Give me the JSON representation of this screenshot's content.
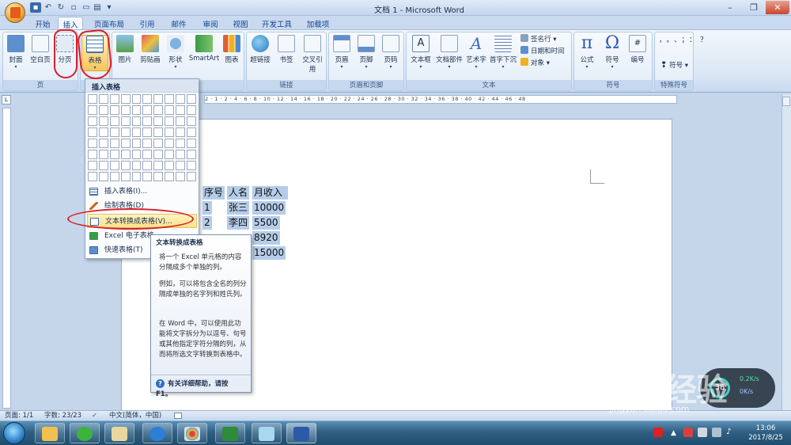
{
  "window": {
    "title": "文档 1 - Microsoft Word"
  },
  "tabs": [
    "开始",
    "插入",
    "页面布局",
    "引用",
    "邮件",
    "审阅",
    "视图",
    "开发工具",
    "加载项"
  ],
  "ribbon": {
    "pages": {
      "label": "页",
      "buttons": [
        "封面",
        "空白页",
        "分页"
      ]
    },
    "tables": {
      "buttons": [
        "表格"
      ]
    },
    "illustrations": {
      "buttons": [
        "图片",
        "剪贴画",
        "形状",
        "SmartArt",
        "图表"
      ]
    },
    "links": {
      "label": "链接",
      "buttons": [
        "超链接",
        "书签",
        "交叉引用"
      ]
    },
    "header_footer": {
      "label": "页眉和页脚",
      "buttons": [
        "页眉",
        "页脚",
        "页码"
      ]
    },
    "text": {
      "label": "文本",
      "buttons": [
        "文本框",
        "文档部件",
        "艺术字",
        "首字下沉"
      ],
      "small": [
        "签名行",
        "日期和时间",
        "对象"
      ]
    },
    "symbols": {
      "label": "符号",
      "buttons": [
        "公式",
        "符号",
        "编号"
      ]
    },
    "special": {
      "label": "特殊符号",
      "small": [
        "符号"
      ]
    }
  },
  "table_menu": {
    "header": "插入表格",
    "items": [
      "插入表格(I)...",
      "绘制表格(D)",
      "文本转换成表格(V)...",
      "Excel 电子表格",
      "快速表格(T)"
    ]
  },
  "tooltip": {
    "title": "文本转换成表格",
    "p1": "将一个 Excel 单元格的内容分隔成多个单独的列。",
    "p2": "例如，可以将包含全名的列分隔成单独的名字列和姓氏列。",
    "p3": "在 Word 中，可以使用此功能将文字拆分为以逗号、句号或其他指定字符分隔的列，从而将所选文字转换到表格中。",
    "footer": "有关详细帮助，请按 F1。"
  },
  "document": {
    "header": [
      "序号",
      "人名",
      "月收入"
    ],
    "rows": [
      [
        "1",
        "张三",
        "10000"
      ],
      [
        "2",
        "李四",
        "5500"
      ],
      [
        "",
        "",
        "8920"
      ],
      [
        "",
        "",
        "15000"
      ]
    ]
  },
  "ruler": {
    "ticks": "2 · 1 · 2 · 4 · 6 · 8 · 10 · 12 · 14 · 16 · 18 · 20 · 22 · 24 · 26 · 28 · 30 · 32 · 34 · 36 · 38 · 40 · 42 · 44 · 46 · 48"
  },
  "status": {
    "page": "页面: 1/1",
    "words": "字数: 23/23",
    "lang": "中文(简体，中国)"
  },
  "speed": {
    "pct": "38",
    "up": "0.2K/s",
    "down": "0K/s"
  },
  "watermark": {
    "main": "Bai 经验",
    "url": "jingyan.baidu.com"
  },
  "clock": {
    "time": "13:06",
    "date": "2017/8/25"
  },
  "colors": {
    "accent": "#15428b",
    "annotation": "#d8202a",
    "highlight": "#fde18a"
  }
}
